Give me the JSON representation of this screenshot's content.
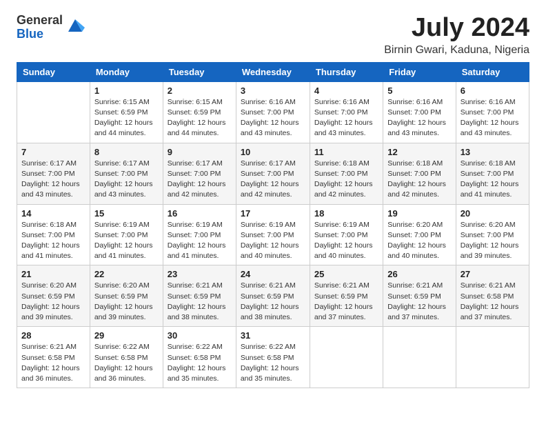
{
  "header": {
    "logo_general": "General",
    "logo_blue": "Blue",
    "month_year": "July 2024",
    "location": "Birnin Gwari, Kaduna, Nigeria"
  },
  "days_of_week": [
    "Sunday",
    "Monday",
    "Tuesday",
    "Wednesday",
    "Thursday",
    "Friday",
    "Saturday"
  ],
  "weeks": [
    [
      {
        "day": "",
        "info": ""
      },
      {
        "day": "1",
        "info": "Sunrise: 6:15 AM\nSunset: 6:59 PM\nDaylight: 12 hours\nand 44 minutes."
      },
      {
        "day": "2",
        "info": "Sunrise: 6:15 AM\nSunset: 6:59 PM\nDaylight: 12 hours\nand 44 minutes."
      },
      {
        "day": "3",
        "info": "Sunrise: 6:16 AM\nSunset: 7:00 PM\nDaylight: 12 hours\nand 43 minutes."
      },
      {
        "day": "4",
        "info": "Sunrise: 6:16 AM\nSunset: 7:00 PM\nDaylight: 12 hours\nand 43 minutes."
      },
      {
        "day": "5",
        "info": "Sunrise: 6:16 AM\nSunset: 7:00 PM\nDaylight: 12 hours\nand 43 minutes."
      },
      {
        "day": "6",
        "info": "Sunrise: 6:16 AM\nSunset: 7:00 PM\nDaylight: 12 hours\nand 43 minutes."
      }
    ],
    [
      {
        "day": "7",
        "info": "Sunrise: 6:17 AM\nSunset: 7:00 PM\nDaylight: 12 hours\nand 43 minutes."
      },
      {
        "day": "8",
        "info": "Sunrise: 6:17 AM\nSunset: 7:00 PM\nDaylight: 12 hours\nand 43 minutes."
      },
      {
        "day": "9",
        "info": "Sunrise: 6:17 AM\nSunset: 7:00 PM\nDaylight: 12 hours\nand 42 minutes."
      },
      {
        "day": "10",
        "info": "Sunrise: 6:17 AM\nSunset: 7:00 PM\nDaylight: 12 hours\nand 42 minutes."
      },
      {
        "day": "11",
        "info": "Sunrise: 6:18 AM\nSunset: 7:00 PM\nDaylight: 12 hours\nand 42 minutes."
      },
      {
        "day": "12",
        "info": "Sunrise: 6:18 AM\nSunset: 7:00 PM\nDaylight: 12 hours\nand 42 minutes."
      },
      {
        "day": "13",
        "info": "Sunrise: 6:18 AM\nSunset: 7:00 PM\nDaylight: 12 hours\nand 41 minutes."
      }
    ],
    [
      {
        "day": "14",
        "info": "Sunrise: 6:18 AM\nSunset: 7:00 PM\nDaylight: 12 hours\nand 41 minutes."
      },
      {
        "day": "15",
        "info": "Sunrise: 6:19 AM\nSunset: 7:00 PM\nDaylight: 12 hours\nand 41 minutes."
      },
      {
        "day": "16",
        "info": "Sunrise: 6:19 AM\nSunset: 7:00 PM\nDaylight: 12 hours\nand 41 minutes."
      },
      {
        "day": "17",
        "info": "Sunrise: 6:19 AM\nSunset: 7:00 PM\nDaylight: 12 hours\nand 40 minutes."
      },
      {
        "day": "18",
        "info": "Sunrise: 6:19 AM\nSunset: 7:00 PM\nDaylight: 12 hours\nand 40 minutes."
      },
      {
        "day": "19",
        "info": "Sunrise: 6:20 AM\nSunset: 7:00 PM\nDaylight: 12 hours\nand 40 minutes."
      },
      {
        "day": "20",
        "info": "Sunrise: 6:20 AM\nSunset: 7:00 PM\nDaylight: 12 hours\nand 39 minutes."
      }
    ],
    [
      {
        "day": "21",
        "info": "Sunrise: 6:20 AM\nSunset: 6:59 PM\nDaylight: 12 hours\nand 39 minutes."
      },
      {
        "day": "22",
        "info": "Sunrise: 6:20 AM\nSunset: 6:59 PM\nDaylight: 12 hours\nand 39 minutes."
      },
      {
        "day": "23",
        "info": "Sunrise: 6:21 AM\nSunset: 6:59 PM\nDaylight: 12 hours\nand 38 minutes."
      },
      {
        "day": "24",
        "info": "Sunrise: 6:21 AM\nSunset: 6:59 PM\nDaylight: 12 hours\nand 38 minutes."
      },
      {
        "day": "25",
        "info": "Sunrise: 6:21 AM\nSunset: 6:59 PM\nDaylight: 12 hours\nand 37 minutes."
      },
      {
        "day": "26",
        "info": "Sunrise: 6:21 AM\nSunset: 6:59 PM\nDaylight: 12 hours\nand 37 minutes."
      },
      {
        "day": "27",
        "info": "Sunrise: 6:21 AM\nSunset: 6:58 PM\nDaylight: 12 hours\nand 37 minutes."
      }
    ],
    [
      {
        "day": "28",
        "info": "Sunrise: 6:21 AM\nSunset: 6:58 PM\nDaylight: 12 hours\nand 36 minutes."
      },
      {
        "day": "29",
        "info": "Sunrise: 6:22 AM\nSunset: 6:58 PM\nDaylight: 12 hours\nand 36 minutes."
      },
      {
        "day": "30",
        "info": "Sunrise: 6:22 AM\nSunset: 6:58 PM\nDaylight: 12 hours\nand 35 minutes."
      },
      {
        "day": "31",
        "info": "Sunrise: 6:22 AM\nSunset: 6:58 PM\nDaylight: 12 hours\nand 35 minutes."
      },
      {
        "day": "",
        "info": ""
      },
      {
        "day": "",
        "info": ""
      },
      {
        "day": "",
        "info": ""
      }
    ]
  ]
}
